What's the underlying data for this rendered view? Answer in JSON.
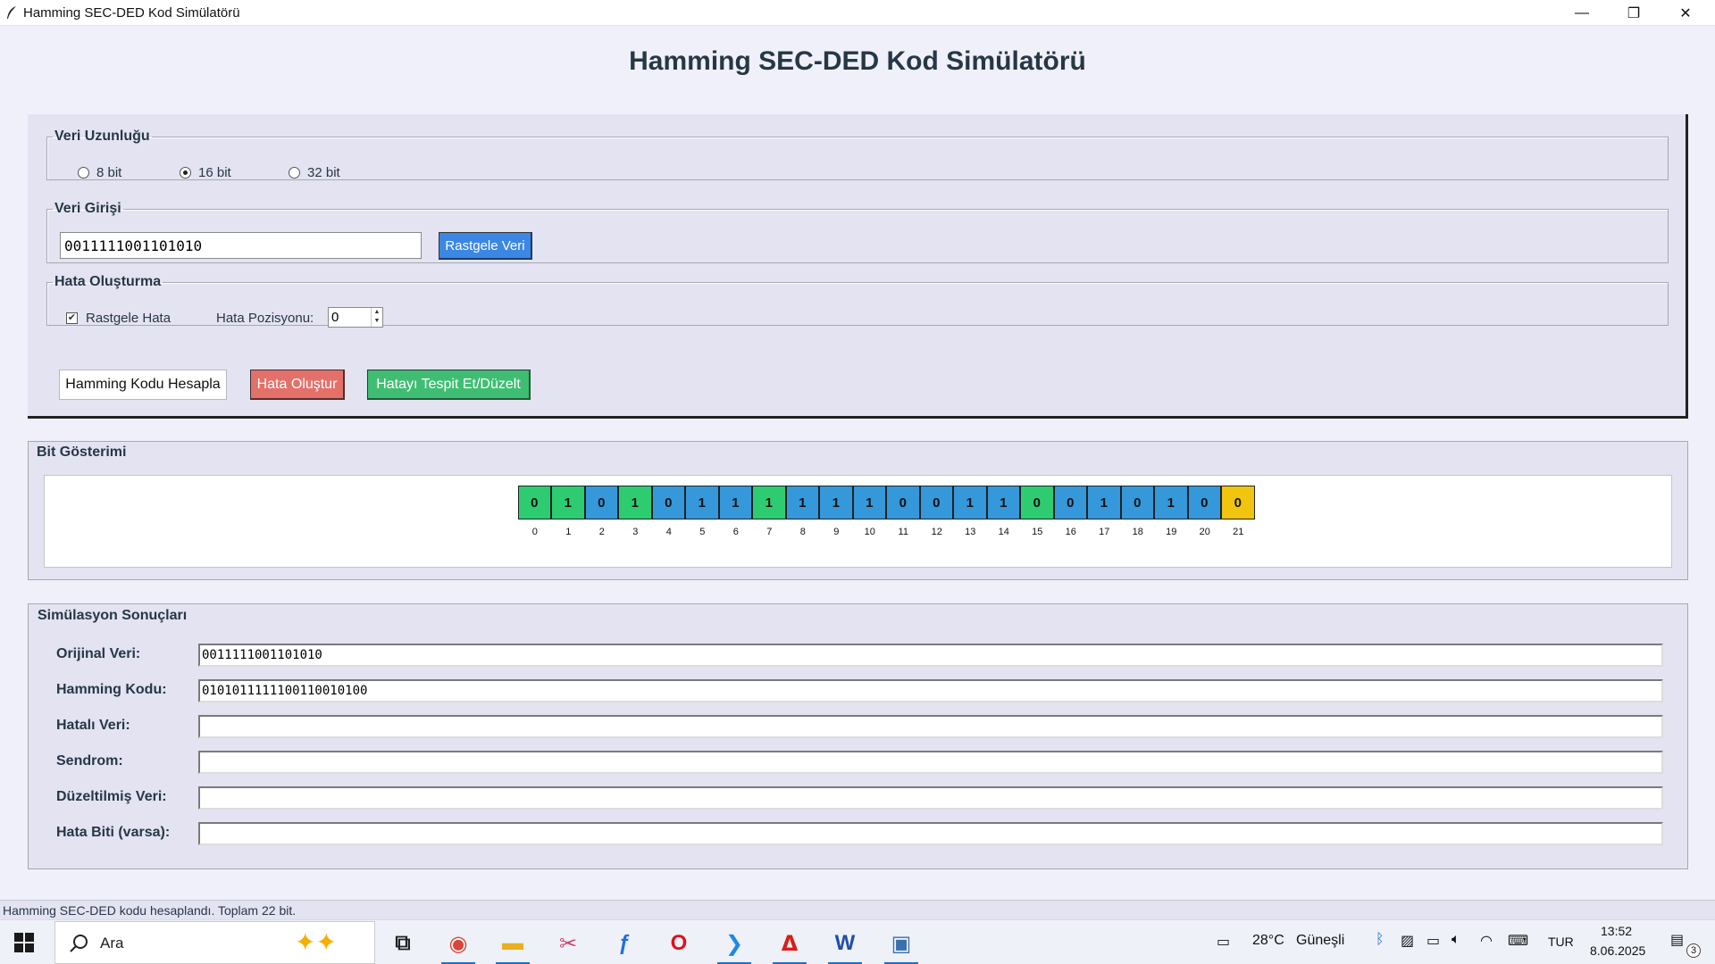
{
  "window": {
    "title": "Hamming SEC-DED Kod Simülatörü",
    "minimize_glyph": "—",
    "maximize_glyph": "❐",
    "close_glyph": "✕"
  },
  "heading": "Hamming SEC-DED Kod Simülatörü",
  "data_length": {
    "legend": "Veri Uzunluğu",
    "options": [
      {
        "label": "8 bit",
        "selected": false
      },
      {
        "label": "16 bit",
        "selected": true
      },
      {
        "label": "32 bit",
        "selected": false
      }
    ]
  },
  "data_input": {
    "legend": "Veri Girişi",
    "value": "0011111001101010",
    "random_button": "Rastgele Veri"
  },
  "error_creation": {
    "legend": "Hata Oluşturma",
    "random_error_label": "Rastgele Hata",
    "random_error_checked": true,
    "position_label": "Hata Pozisyonu:",
    "position_value": "0"
  },
  "actions": {
    "compute": "Hamming Kodu Hesapla",
    "inject": "Hata Oluştur",
    "detect": "Hatayı Tespit Et/Düzelt"
  },
  "bit_display": {
    "title": "Bit Gösterimi",
    "bits": [
      {
        "index": "0",
        "value": "0",
        "kind": "parity"
      },
      {
        "index": "1",
        "value": "1",
        "kind": "parity"
      },
      {
        "index": "2",
        "value": "0",
        "kind": "data"
      },
      {
        "index": "3",
        "value": "1",
        "kind": "parity"
      },
      {
        "index": "4",
        "value": "0",
        "kind": "data"
      },
      {
        "index": "5",
        "value": "1",
        "kind": "data"
      },
      {
        "index": "6",
        "value": "1",
        "kind": "data"
      },
      {
        "index": "7",
        "value": "1",
        "kind": "parity"
      },
      {
        "index": "8",
        "value": "1",
        "kind": "data"
      },
      {
        "index": "9",
        "value": "1",
        "kind": "data"
      },
      {
        "index": "10",
        "value": "1",
        "kind": "data"
      },
      {
        "index": "11",
        "value": "0",
        "kind": "data"
      },
      {
        "index": "12",
        "value": "0",
        "kind": "data"
      },
      {
        "index": "13",
        "value": "1",
        "kind": "data"
      },
      {
        "index": "14",
        "value": "1",
        "kind": "data"
      },
      {
        "index": "15",
        "value": "0",
        "kind": "parity"
      },
      {
        "index": "16",
        "value": "0",
        "kind": "data"
      },
      {
        "index": "17",
        "value": "1",
        "kind": "data"
      },
      {
        "index": "18",
        "value": "0",
        "kind": "data"
      },
      {
        "index": "19",
        "value": "1",
        "kind": "data"
      },
      {
        "index": "20",
        "value": "0",
        "kind": "data"
      },
      {
        "index": "21",
        "value": "0",
        "kind": "overall"
      }
    ],
    "colors": {
      "parity": "#2ecc71",
      "data": "#3498db",
      "overall": "#f1c40f"
    }
  },
  "results": {
    "title": "Simülasyon Sonuçları",
    "rows": [
      {
        "label": "Orijinal Veri:",
        "value": "0011111001101010"
      },
      {
        "label": "Hamming Kodu:",
        "value": "0101011111100110010100"
      },
      {
        "label": "Hatalı Veri:",
        "value": ""
      },
      {
        "label": "Sendrom:",
        "value": ""
      },
      {
        "label": "Düzeltilmiş Veri:",
        "value": ""
      },
      {
        "label": "Hata Biti (varsa):",
        "value": ""
      }
    ]
  },
  "status": "Hamming SEC-DED kodu hesaplandı. Toplam 22 bit.",
  "taskbar": {
    "search_placeholder": "Ara",
    "weather": "28°C",
    "weather_desc": "Güneşli",
    "language": "TUR",
    "time": "13:52",
    "date": "8.06.2025",
    "notification_count": "3"
  }
}
